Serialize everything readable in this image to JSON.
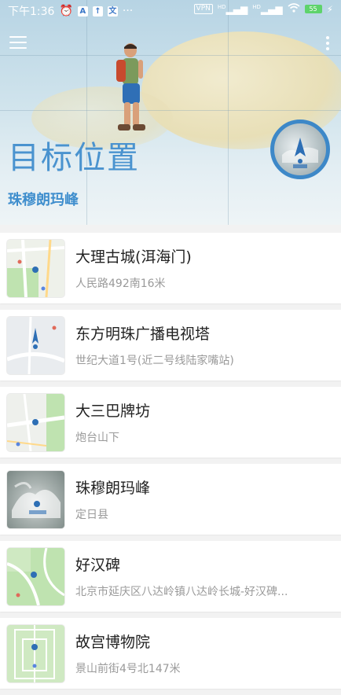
{
  "status_bar": {
    "time": "下午1:36",
    "icons": [
      "alarm-icon",
      "a-app-icon",
      "upload-icon",
      "translate-icon",
      "more-dots-icon"
    ],
    "right_icons": [
      "vpn-icon",
      "signal-icon",
      "signal-icon",
      "wifi-icon",
      "battery-icon"
    ],
    "vpn": "VPN",
    "hd1": "HD",
    "hd2": "HD",
    "battery": "55"
  },
  "header": {
    "title": "目标位置",
    "subtitle": "珠穆朗玛峰",
    "menu_icon": "menu-icon",
    "more_icon": "more-vert-icon"
  },
  "places": [
    {
      "name": "大理古城(洱海门)",
      "address": "人民路492南16米",
      "thumb_type": "road"
    },
    {
      "name": "东方明珠广播电视塔",
      "address": "世纪大道1号(近二号线陆家嘴站)",
      "thumb_type": "road"
    },
    {
      "name": "大三巴牌坊",
      "address": "炮台山下",
      "thumb_type": "road"
    },
    {
      "name": "珠穆朗玛峰",
      "address": "定日县",
      "thumb_type": "satellite"
    },
    {
      "name": "好汉碑",
      "address": "北京市延庆区八达岭镇八达岭长城-好汉碑...",
      "thumb_type": "road"
    },
    {
      "name": "故宫博物院",
      "address": "景山前街4号北147米",
      "thumb_type": "road"
    }
  ],
  "colors": {
    "accent": "#4a93cf",
    "title_text": "#222222",
    "address_text": "#9a9a9a"
  }
}
